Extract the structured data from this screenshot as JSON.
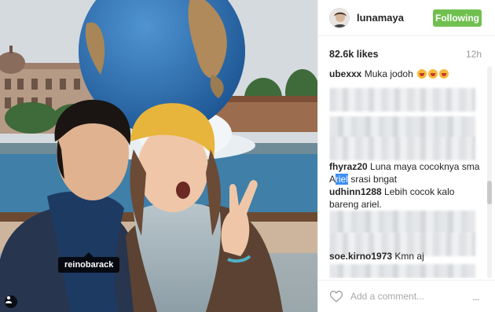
{
  "photo": {
    "tagged_user": "reinobarack",
    "icons": {
      "user_tag": "person-icon"
    }
  },
  "post": {
    "username": "lunamaya",
    "follow_label": "Following",
    "likes": "82.6k likes",
    "time": "12h",
    "comments": [
      {
        "user": "ubexxx",
        "text": "Muka jodoh",
        "emoji_count": 3
      },
      {
        "user": "fhyraz20",
        "text_before": "Luna maya cocoknya sma A",
        "highlight": "riel",
        "text_after": " srasi bngat"
      },
      {
        "user": "udhinn1288",
        "text": "Lebih cocok kalo bareng ariel."
      },
      {
        "user": "soe.kirno1973",
        "text": "Kmn aj"
      }
    ],
    "add_comment_placeholder": "Add a comment...",
    "more_label": "...",
    "icons": {
      "like": "heart-icon",
      "more": "more-options-icon"
    }
  },
  "colors": {
    "follow_button": "#70c050",
    "selection_highlight": "#3d8ef0"
  }
}
